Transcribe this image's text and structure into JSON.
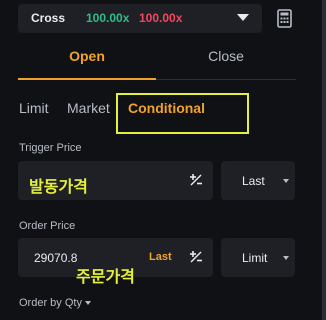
{
  "leverage": {
    "mode": "Cross",
    "long": "100.00x",
    "short": "100.00x"
  },
  "tabs": {
    "open": "Open",
    "close": "Close",
    "active": "Open"
  },
  "order_types": {
    "limit": "Limit",
    "market": "Market",
    "conditional": "Conditional",
    "active": "Conditional"
  },
  "trigger_price": {
    "label": "Trigger Price",
    "value": "",
    "type_select": "Last"
  },
  "order_price": {
    "label": "Order Price",
    "value": "29070.8",
    "last_tag": "Last",
    "type_select": "Limit"
  },
  "order_by": {
    "label": "Order by Qty"
  },
  "annotations": {
    "trigger": "발동가격",
    "order": "주문가격"
  },
  "colors": {
    "accent": "#f0a22b",
    "long": "#2ebd85",
    "short": "#f6465d",
    "annotation": "#e6f03a",
    "background": "#101114",
    "panel": "#1e2026"
  },
  "icons": {
    "calculator": "calculator-icon",
    "plus_minus": "plus-minus-icon",
    "dropdown": "chevron-down-icon"
  }
}
